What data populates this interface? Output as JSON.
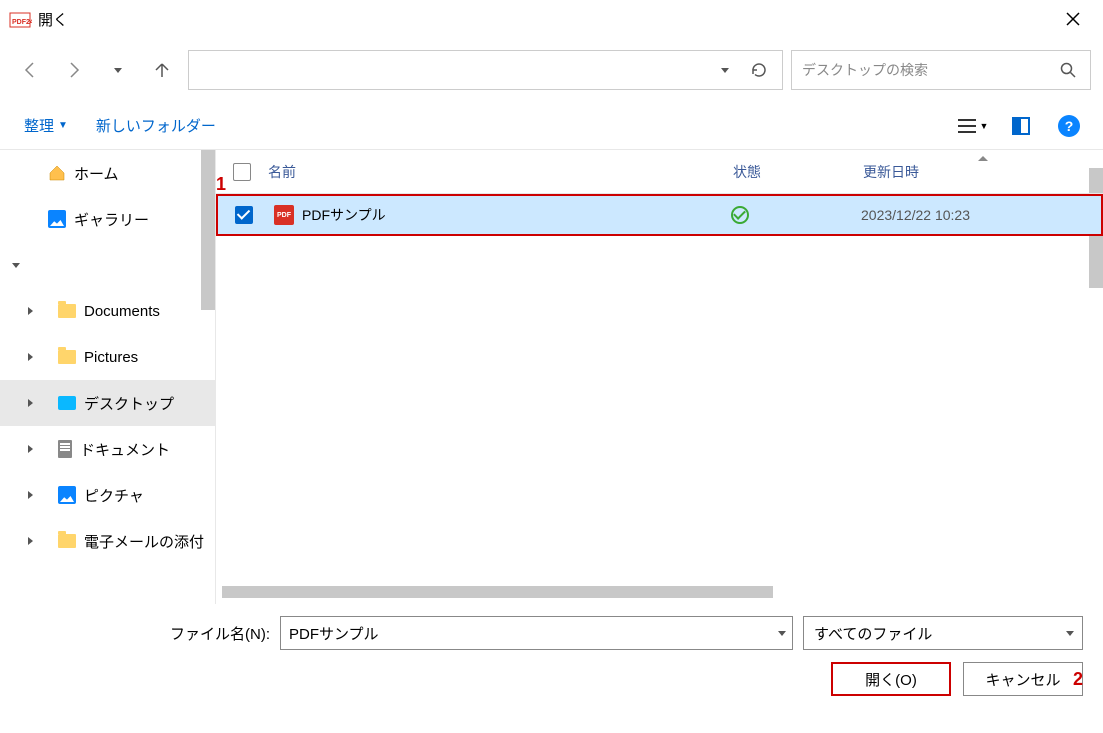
{
  "window": {
    "title": "開く"
  },
  "search": {
    "placeholder": "デスクトップの検索"
  },
  "toolbar": {
    "organize": "整理",
    "newfolder": "新しいフォルダー"
  },
  "sidebar": {
    "home": "ホーム",
    "gallery": "ギャラリー",
    "documents": "Documents",
    "pictures": "Pictures",
    "desktop": "デスクトップ",
    "document_jp": "ドキュメント",
    "picture_jp": "ピクチャ",
    "email_attach": "電子メールの添付"
  },
  "columns": {
    "name": "名前",
    "state": "状態",
    "modified": "更新日時"
  },
  "files": [
    {
      "name": "PDFサンプル",
      "date": "2023/12/22 10:23"
    }
  ],
  "annotations": {
    "one": "1",
    "two": "2"
  },
  "bottom": {
    "filename_label": "ファイル名(N):",
    "filename_value": "PDFサンプル",
    "filter": "すべてのファイル",
    "open": "開く(O)",
    "cancel": "キャンセル"
  }
}
